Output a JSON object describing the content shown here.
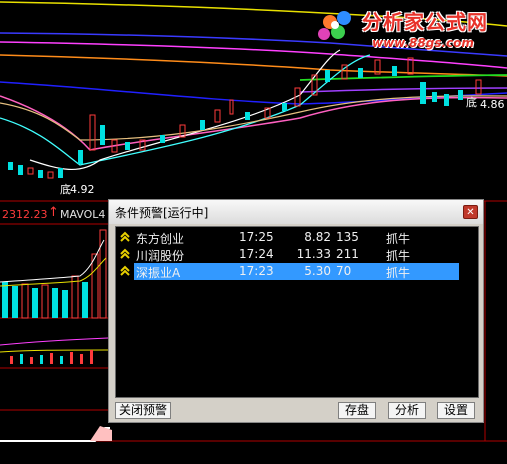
{
  "watermark": {
    "title": "分析家公式网",
    "url": "www.88gs.com"
  },
  "chart": {
    "low_marker_left": "底",
    "low_value_left": "4.92",
    "low_marker_right": "底",
    "low_value_right": "4.86",
    "index_readout": "2312.23",
    "volume_indicator": "MAVOL4"
  },
  "dialog": {
    "title": "条件预警[运行中]",
    "rows": [
      {
        "name": "东方创业",
        "time": "17:25",
        "price": "8.82",
        "volume": "135",
        "signal": "抓牛",
        "selected": false
      },
      {
        "name": "川润股份",
        "time": "17:24",
        "price": "11.33",
        "volume": "211",
        "signal": "抓牛",
        "selected": false
      },
      {
        "name": "深振业A",
        "time": "17:23",
        "price": "5.30",
        "volume": "70",
        "signal": "抓牛",
        "selected": true
      }
    ],
    "buttons": {
      "close_alert": "关闭预警",
      "save": "存盘",
      "analyze": "分析",
      "settings": "设置"
    }
  },
  "colors": {
    "selection": "#3399ff",
    "up": "#ff3b3b",
    "down": "#00e0e0"
  }
}
